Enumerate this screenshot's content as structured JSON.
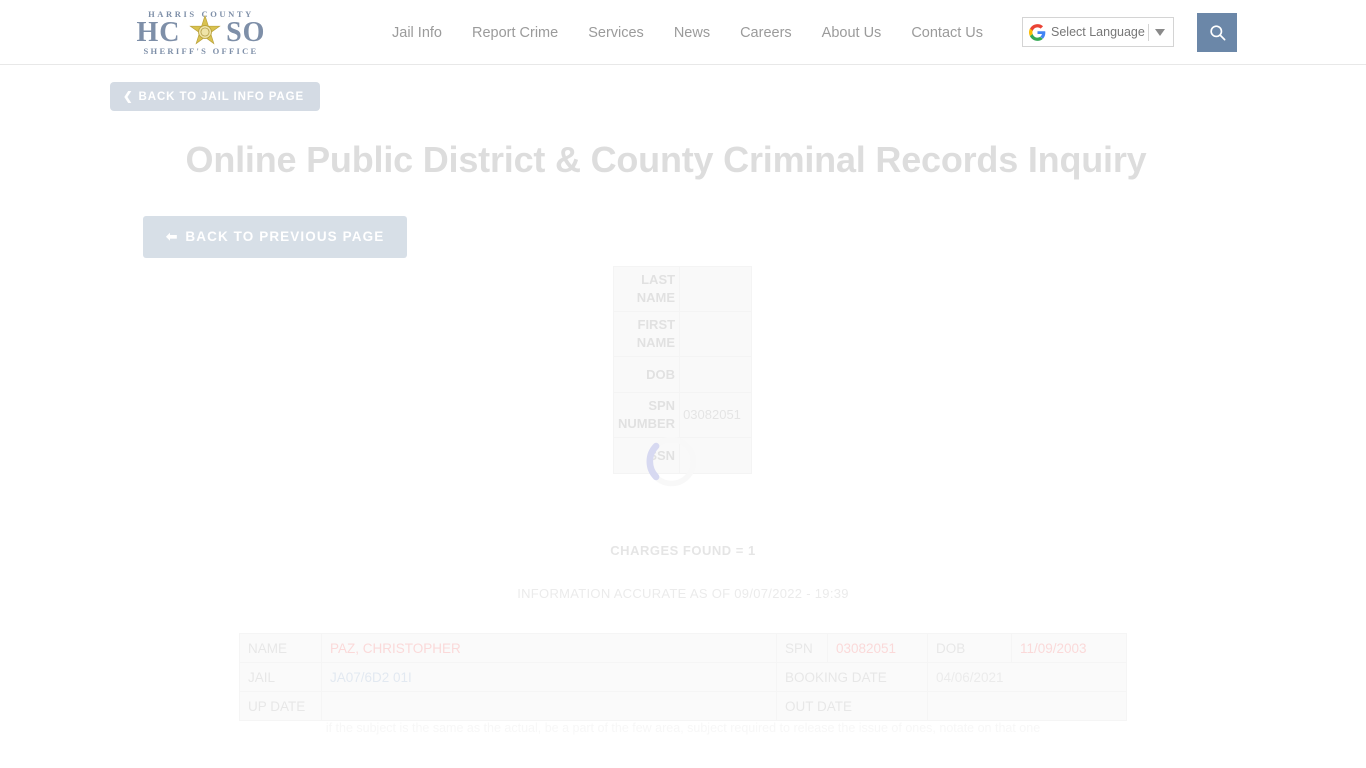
{
  "header": {
    "logo": {
      "top_text": "HARRIS   COUNTY",
      "main_text_left": "HC",
      "main_text_right": "SO",
      "bottom_text": "SHERIFF'S   OFFICE",
      "star_color": "#d4b945",
      "text_color": "#7e8fa8"
    },
    "nav": [
      {
        "label": "Jail Info"
      },
      {
        "label": "Report Crime"
      },
      {
        "label": "Services"
      },
      {
        "label": "News"
      },
      {
        "label": "Careers"
      },
      {
        "label": "About Us"
      },
      {
        "label": "Contact Us"
      }
    ],
    "language_widget": {
      "label": "Select Language",
      "icon": "google-g-icon"
    },
    "search_button": {
      "icon": "search-icon",
      "color": "#6b87a8"
    }
  },
  "body": {
    "back_to_jail_info": "BACK TO JAIL INFO PAGE",
    "page_title": "Online Public District & County Criminal Records Inquiry",
    "back_to_previous": "BACK TO PREVIOUS PAGE",
    "search_form": {
      "rows": [
        {
          "label": "LAST NAME",
          "value": ""
        },
        {
          "label": "FIRST NAME",
          "value": ""
        },
        {
          "label": "DOB",
          "value": ""
        },
        {
          "label": "SPN NUMBER",
          "value": "03082051"
        },
        {
          "label": "SSN",
          "value": ""
        }
      ]
    },
    "loading_spinner": {
      "visible": true,
      "arc_color": "#7b7fd0",
      "track_color": "#e4e4e4"
    },
    "charges_found": "CHARGES FOUND = 1",
    "information_accurate": "INFORMATION ACCURATE AS OF 09/07/2022 - 19:39",
    "result_table": {
      "rows": [
        [
          {
            "text": "NAME",
            "style": "label"
          },
          {
            "text": "PAZ, CHRISTOPHER",
            "style": "red"
          },
          {
            "text": "SPN",
            "style": "label"
          },
          {
            "text": "03082051",
            "style": "red"
          },
          {
            "text": "DOB",
            "style": "label"
          },
          {
            "text": "11/09/2003",
            "style": "red"
          }
        ],
        [
          {
            "text": "JAIL",
            "style": "label"
          },
          {
            "text": "JA07/6D2 01I",
            "style": "blue"
          },
          {
            "text": "BOOKING DATE",
            "style": "label"
          },
          {
            "text": "04/06/2021",
            "style": "gray"
          }
        ],
        [
          {
            "text": "UP DATE",
            "style": "label"
          },
          {
            "text": "",
            "style": "gray"
          },
          {
            "text": "OUT DATE",
            "style": "label"
          },
          {
            "text": "",
            "style": "gray"
          }
        ]
      ]
    },
    "footnote": "if the subject is the same as the actual, be a part of the few area, subject required to release the issue of ones, notate on that one"
  }
}
